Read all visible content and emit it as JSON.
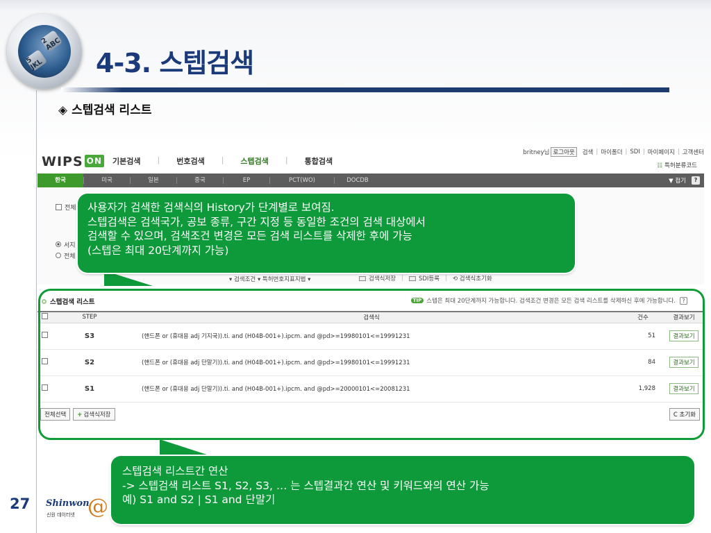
{
  "slide": {
    "title": "4-3. 스텝검색",
    "subtitle_marker": "◈",
    "subtitle": "스텝검색 리스트",
    "page_number": "27",
    "footer_logo": "Shinwon",
    "footer_logo_sub": "신원 데이터넷",
    "footer_logo_mark": "@",
    "dial_keys": [
      "2 ABC",
      "5 JKL"
    ]
  },
  "site": {
    "logo_text": "WIPS",
    "logo_badge": "ON",
    "gnb": [
      "기본검색",
      "번호검색",
      "스텝검색",
      "통합검색"
    ],
    "gnb_sep": "|",
    "active_gnb": "스텝검색",
    "user_name": "britney님",
    "logout": "로그아웃",
    "util_links": [
      "검색",
      "마이폴더",
      "SDI",
      "마이페이지",
      "고객센터"
    ],
    "classify_link": "특허분류코드",
    "country_tabs": [
      "한국",
      "미국",
      "일본",
      "중국",
      "EP",
      "PCT(WO)",
      "DOCDB"
    ],
    "fold_label": "▼ 접기",
    "help_label": "?"
  },
  "search_area": {
    "all_check_label": "전체",
    "radio_1": "서지",
    "radio_2": "전체",
    "history_select": "▾ 검색조건 ▾   특허번호지표지법 ▾",
    "tools": [
      "검색식저장",
      "SDI등록",
      "검색식초기화"
    ]
  },
  "step_list": {
    "title": "스텝검색 리스트",
    "tip_badge": "TIP",
    "tip_text": "스텝은 최대 20단계까지 가능합니다. 검색조건 변경은 모든 검색 리스트를 삭제하신 후에 가능합니다.",
    "tip_help": "?",
    "headers": {
      "step": "STEP",
      "query": "검색식",
      "count": "건수",
      "view": "결과보기"
    },
    "rows": [
      {
        "step": "S3",
        "query": "(핸드폰 or (휴대용 adj 기지국)).ti. and (H04B-001+).ipcm. and @pd>=19980101<=19991231",
        "count": "51",
        "view": "결과보기"
      },
      {
        "step": "S2",
        "query": "(핸드폰 or (휴대용 adj 단말기)).ti. and (H04B-001+).ipcm. and @pd>=19980101<=19991231",
        "count": "84",
        "view": "결과보기"
      },
      {
        "step": "S1",
        "query": "(핸드폰 or (휴대용 adj 단말기)).ti. and (H04B-001+).ipcm. and @pd>=20000101<=20081231",
        "count": "1,928",
        "view": "결과보기"
      }
    ],
    "select_all": "전체선택",
    "save_query": "검색식저장",
    "save_query_prefix": "+",
    "reset": "초기화",
    "reset_prefix": "C"
  },
  "callouts": {
    "top": [
      "사용자가 검색한 검색식의 History가 단계별로 보여짐.",
      "스텝검색은 검색국가, 공보 종류, 구간 지정 등 동일한 조건의 검색 대상에서",
      "검색할 수 있으며, 검색조건 변경은 모든 검색 리스트를 삭제한 후에 가능",
      "(스텝은 최대 20단계까지 가능)"
    ],
    "bottom": [
      "스텝검색 리스트간 연산",
      "-> 스텝검색 리스트 S1, S2, S3, … 는 스텝결과간 연산 및 키워드와의 연산 가능",
      "예) S1 and S2 | S1 and 단말기"
    ]
  },
  "colors": {
    "callout_green": "#0e9a3a",
    "title_blue": "#1b3a7a",
    "active_tab_green": "#3f9a2c"
  }
}
